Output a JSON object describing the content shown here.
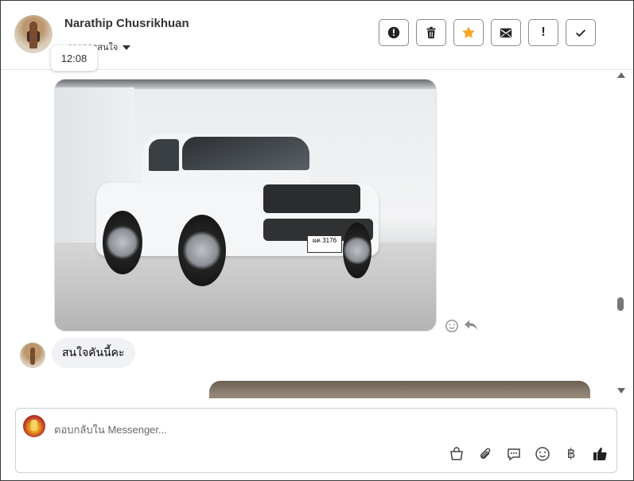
{
  "header": {
    "name": "Narathip Chusrikhuan",
    "subtitle": "รายการสนใจ",
    "tooltip_time": "12:08",
    "actions": [
      {
        "icon": "alert-circle-icon",
        "label": "!"
      },
      {
        "icon": "trash-icon"
      },
      {
        "icon": "star-icon",
        "color": "#f5a623"
      },
      {
        "icon": "mark-unread-icon"
      },
      {
        "icon": "exclamation-icon",
        "label": "!"
      },
      {
        "icon": "check-icon"
      }
    ]
  },
  "thread": {
    "image_plate": "ผค 3176",
    "incoming_message": "สนใจคันนี้คะ"
  },
  "composer": {
    "placeholder": "ตอบกลับใน Messenger...",
    "tools": [
      "bag-icon",
      "paperclip-icon",
      "chat-bubble-icon",
      "emoji-icon",
      "baht-icon",
      "thumbs-up-icon"
    ],
    "baht_symbol": "฿"
  }
}
